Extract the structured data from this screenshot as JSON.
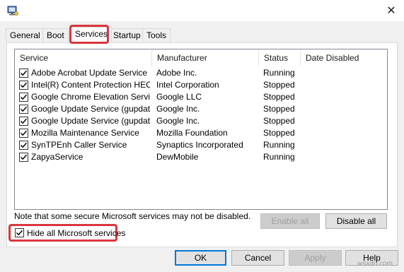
{
  "tabs": [
    {
      "label": "General"
    },
    {
      "label": "Boot"
    },
    {
      "label": "Services"
    },
    {
      "label": "Startup"
    },
    {
      "label": "Tools"
    }
  ],
  "active_tab": "Services",
  "columns": [
    "Service",
    "Manufacturer",
    "Status",
    "Date Disabled"
  ],
  "services": [
    {
      "name": "Adobe Acrobat Update Service",
      "manufacturer": "Adobe Inc.",
      "status": "Running",
      "date_disabled": "",
      "checked": true
    },
    {
      "name": "Intel(R) Content Protection HEC...",
      "manufacturer": "Intel Corporation",
      "status": "Stopped",
      "date_disabled": "",
      "checked": true
    },
    {
      "name": "Google Chrome Elevation Servic...",
      "manufacturer": "Google LLC",
      "status": "Stopped",
      "date_disabled": "",
      "checked": true
    },
    {
      "name": "Google Update Service (gupdate)",
      "manufacturer": "Google Inc.",
      "status": "Stopped",
      "date_disabled": "",
      "checked": true
    },
    {
      "name": "Google Update Service (gupdatem)",
      "manufacturer": "Google Inc.",
      "status": "Stopped",
      "date_disabled": "",
      "checked": true
    },
    {
      "name": "Mozilla Maintenance Service",
      "manufacturer": "Mozilla Foundation",
      "status": "Stopped",
      "date_disabled": "",
      "checked": true
    },
    {
      "name": "SynTPEnh Caller Service",
      "manufacturer": "Synaptics Incorporated",
      "status": "Running",
      "date_disabled": "",
      "checked": true
    },
    {
      "name": "ZapyaService",
      "manufacturer": "DewMobile",
      "status": "Running",
      "date_disabled": "",
      "checked": true
    }
  ],
  "note": "Note that some secure Microsoft services may not be disabled.",
  "enable_all_label": "Enable all",
  "disable_all_label": "Disable all",
  "hide_ms_label": "Hide all Microsoft services",
  "hide_ms_checked": true,
  "buttons": {
    "ok": "OK",
    "cancel": "Cancel",
    "apply": "Apply",
    "help": "Help"
  },
  "close_glyph": "✕",
  "watermark": "wsxdn.com",
  "icons": {
    "app": "system-config-icon",
    "close": "close-icon",
    "check": "checkmark-icon"
  },
  "colors": {
    "highlight": "#d9363e",
    "default_button": "#0078d7"
  }
}
